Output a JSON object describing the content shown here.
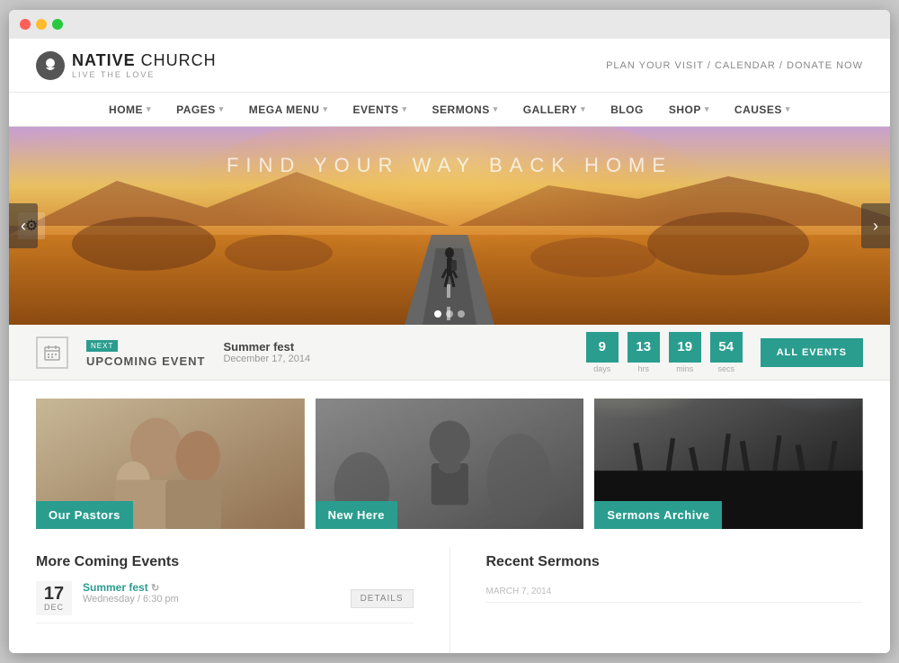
{
  "browser": {
    "dots": [
      "red",
      "yellow",
      "green"
    ]
  },
  "header": {
    "logo_name": "NATIVE",
    "logo_name2": " CHURCH",
    "logo_tagline": "LIVE THE LOVE",
    "nav_links": "PLAN YOUR VISIT  /  CALENDAR  /  DONATE NOW"
  },
  "nav": {
    "items": [
      {
        "label": "HOME",
        "arrow": true
      },
      {
        "label": "PAGES",
        "arrow": true
      },
      {
        "label": "MEGA MENU",
        "arrow": true
      },
      {
        "label": "EVENTS",
        "arrow": true
      },
      {
        "label": "SERMONS",
        "arrow": true
      },
      {
        "label": "GALLERY",
        "arrow": true
      },
      {
        "label": "BLOG",
        "arrow": false
      },
      {
        "label": "SHOP",
        "arrow": true
      },
      {
        "label": "CAUSES",
        "arrow": true
      }
    ]
  },
  "hero": {
    "text": "FIND YOUR WAY BACK HOME",
    "prev_arrow": "‹",
    "next_arrow": "›"
  },
  "events_bar": {
    "next_label": "NEXT",
    "upcoming_label": "UPCOMING EVENT",
    "event_name": "Summer fest",
    "event_date": "December 17, 2014",
    "countdown": {
      "days_num": "9",
      "days_label": "days",
      "hrs_num": "13",
      "hrs_label": "hrs",
      "mins_num": "19",
      "mins_label": "mins",
      "secs_num": "54",
      "secs_label": "secs"
    },
    "all_events_btn": "ALL EVENTS"
  },
  "cards": [
    {
      "label": "Our Pastors",
      "id": "our-pastors"
    },
    {
      "label": "New Here",
      "id": "new-here"
    },
    {
      "label": "Sermons Archive",
      "id": "sermons-archive"
    }
  ],
  "more_events": {
    "title": "More Coming Events",
    "items": [
      {
        "day": "17",
        "month": "DEC",
        "title": "Summer fest",
        "time": "Wednesday / 6:30 pm",
        "details_btn": "DETAILS"
      }
    ]
  },
  "recent_sermons": {
    "title": "Recent Sermons",
    "items": [
      {
        "date": "MARCH 7, 2014"
      }
    ]
  }
}
